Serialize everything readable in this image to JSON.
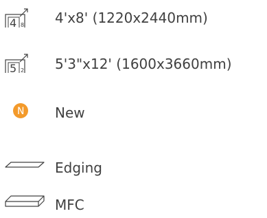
{
  "legend": {
    "items": [
      {
        "icon": "sheet-size-4x8-icon",
        "number": "4",
        "subscript": "8",
        "label": "4'x8' (1220x2440mm)"
      },
      {
        "icon": "sheet-size-5x12-icon",
        "number": "5",
        "subscript": "2",
        "label": "5'3\"x12' (1600x3660mm)"
      },
      {
        "icon": "new-badge-icon",
        "letter": "N",
        "color": "#f39a2b",
        "label": "New"
      },
      {
        "icon": "edging-strip-icon",
        "label": "Edging"
      },
      {
        "icon": "mfc-board-icon",
        "label": "MFC"
      }
    ]
  }
}
